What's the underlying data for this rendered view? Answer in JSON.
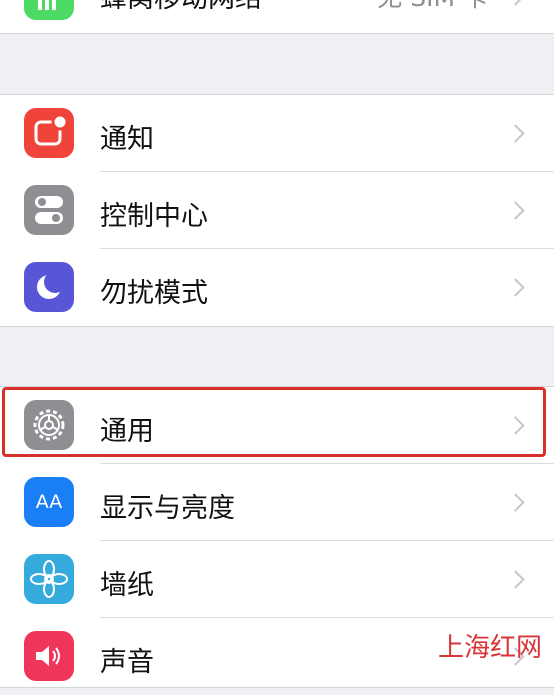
{
  "top_row": {
    "label": "蜂窝移动网络",
    "value": "无 SIM 卡",
    "icon": "cellular-icon",
    "color": "#4cd964"
  },
  "group1": [
    {
      "label": "通知",
      "icon": "notifications-icon",
      "color": "#f0443a"
    },
    {
      "label": "控制中心",
      "icon": "control-center-icon",
      "color": "#8e8e93"
    },
    {
      "label": "勿扰模式",
      "icon": "moon-icon",
      "color": "#5856d6"
    }
  ],
  "group2": [
    {
      "label": "通用",
      "icon": "gear-icon",
      "color": "#8e8e93"
    },
    {
      "label": "显示与亮度",
      "icon": "display-brightness-icon",
      "color": "#1a7ef5",
      "icon_text": "AA"
    },
    {
      "label": "墙纸",
      "icon": "wallpaper-icon",
      "color": "#35aadc"
    },
    {
      "label": "声音",
      "icon": "sound-icon",
      "color": "#f0355b"
    }
  ],
  "watermark": "上海红网"
}
